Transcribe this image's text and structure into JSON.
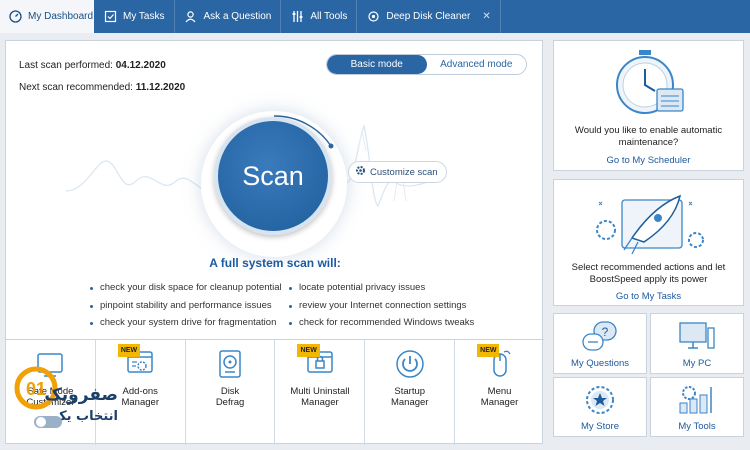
{
  "tabs": [
    {
      "label": "My Dashboard",
      "icon": "dashboard-icon",
      "active": true
    },
    {
      "label": "My Tasks",
      "icon": "tasks-icon"
    },
    {
      "label": "Ask a Question",
      "icon": "person-icon"
    },
    {
      "label": "All Tools",
      "icon": "tools-icon"
    },
    {
      "label": "Deep Disk Cleaner",
      "icon": "settings-icon",
      "closable": true
    }
  ],
  "scan": {
    "last_label": "Last scan performed:",
    "last_date": "04.12.2020",
    "next_label": "Next scan recommended:",
    "next_date": "11.12.2020",
    "button": "Scan",
    "customize": "Customize scan"
  },
  "mode": {
    "basic": "Basic mode",
    "advanced": "Advanced mode"
  },
  "fullscan": {
    "title": "A full system scan will:",
    "left": [
      "check your disk space for cleanup potential",
      "pinpoint stability and performance issues",
      "check your system drive for fragmentation"
    ],
    "right": [
      "locate potential privacy issues",
      "review your Internet connection settings",
      "check for recommended Windows tweaks"
    ]
  },
  "tools": [
    {
      "line1": "Safe Mode",
      "line2": "Customizer",
      "new": false
    },
    {
      "line1": "Add-ons",
      "line2": "Manager",
      "new": true
    },
    {
      "line1": "Disk",
      "line2": "Defrag",
      "new": false
    },
    {
      "line1": "Multi Uninstall",
      "line2": "Manager",
      "new": true
    },
    {
      "line1": "Startup",
      "line2": "Manager",
      "new": false
    },
    {
      "line1": "Menu",
      "line2": "Manager",
      "new": true
    }
  ],
  "new_badge": "NEW",
  "scheduler": {
    "text1": "Would you like to enable automatic",
    "text2": "maintenance?",
    "link": "Go to My Scheduler"
  },
  "tasks_panel": {
    "text1": "Select recommended actions and let",
    "text2": "BoostSpeed apply its power",
    "link": "Go to My Tasks"
  },
  "grid": [
    {
      "label": "My Questions",
      "icon": "questions-icon"
    },
    {
      "label": "My PC",
      "icon": "pc-icon"
    },
    {
      "label": "My Store",
      "icon": "store-icon"
    },
    {
      "label": "My Tools",
      "icon": "mytools-icon"
    }
  ],
  "watermark": {
    "text": "صفرویک",
    "sub": "انتخاب یک",
    "logo": "01"
  },
  "colors": {
    "accent": "#2a66a3",
    "link": "#1e5aa0",
    "badge": "#f2b705"
  }
}
